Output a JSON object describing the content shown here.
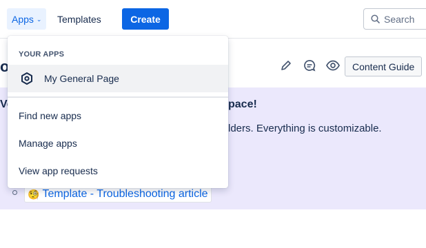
{
  "nav": {
    "apps_label": "Apps",
    "templates_label": "Templates",
    "create_label": "Create",
    "search_placeholder": "Search"
  },
  "page": {
    "title_fragment": "or",
    "content_guide_label": "Content Guide",
    "panel": {
      "heading_left": "Ve",
      "heading_right": "pace!",
      "body_right": "lders. Everything is customizable.",
      "template_link": "Template - Troubleshooting article",
      "template_emoji": "🧐"
    }
  },
  "apps_menu": {
    "section_label": "YOUR APPS",
    "apps": [
      {
        "label": "My General Page",
        "icon": "hexagon-app-icon"
      }
    ],
    "links": [
      {
        "label": "Find new apps"
      },
      {
        "label": "Manage apps"
      },
      {
        "label": "View app requests"
      }
    ]
  },
  "colors": {
    "brand": "#0c66e4",
    "panel_background": "#ebe8fc",
    "text": "#172b4d"
  }
}
